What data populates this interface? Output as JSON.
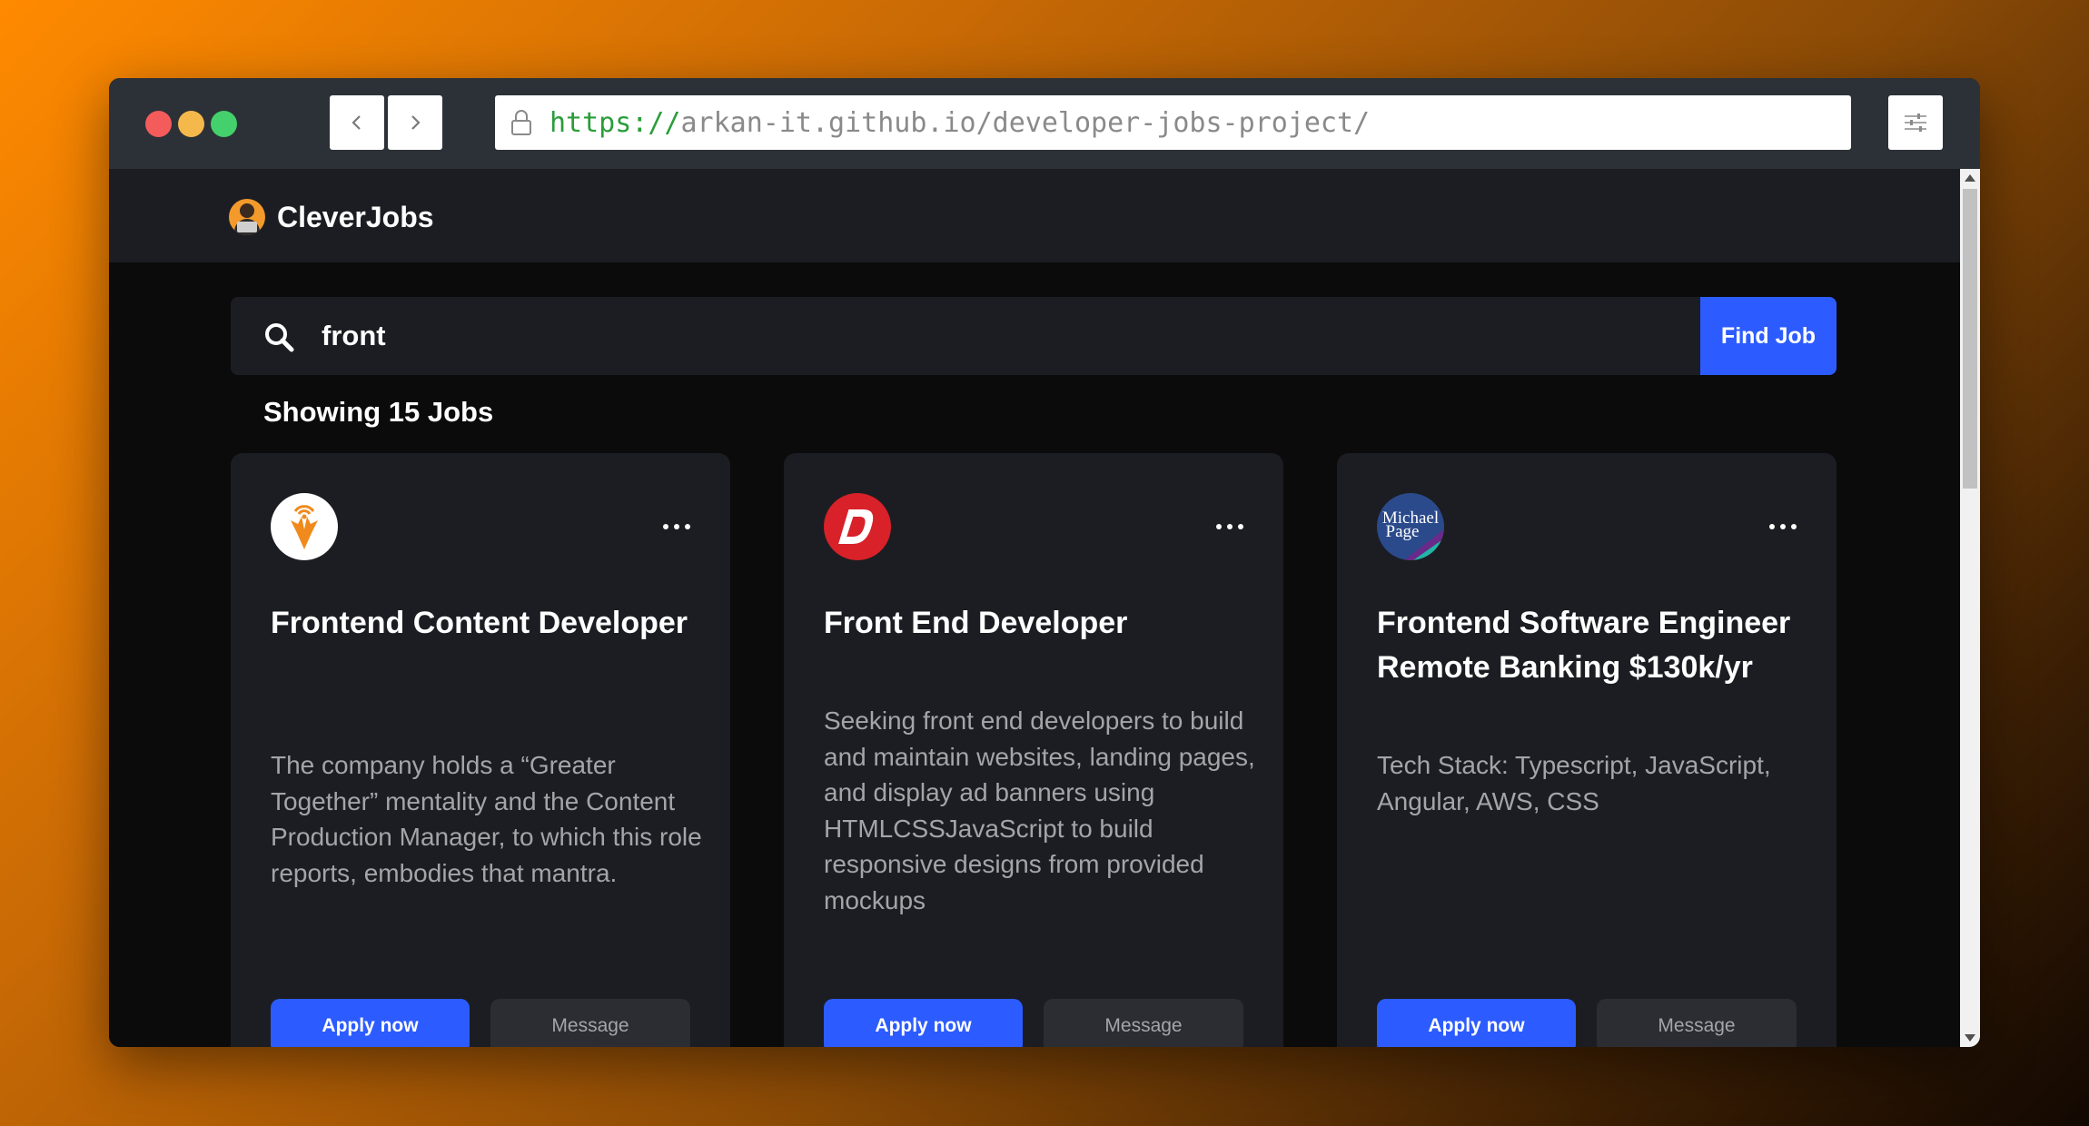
{
  "browser": {
    "url_scheme": "https://",
    "url_rest": "arkan-it.github.io/developer-jobs-project/"
  },
  "brand": {
    "name": "CleverJobs"
  },
  "search": {
    "value": "front",
    "button_label": "Find Job"
  },
  "results": {
    "count_label": "Showing 15 Jobs"
  },
  "colors": {
    "accent": "#2c5cff",
    "card_bg": "#1c1d22",
    "page_bg": "#0b0b0c"
  },
  "jobs": [
    {
      "title": "Frontend Content Developer",
      "description": "The company holds a “Greater Together” mentality and the Content Production Manager, to which this role reports, embodies that mantra.",
      "logo": "deer-logo-icon",
      "apply_label": "Apply now",
      "message_label": "Message"
    },
    {
      "title": "Front End Developer",
      "description": "Seeking front end developers to build and maintain websites, landing pages, and display ad banners using HTMLCSSJavaScript to build responsive designs from provided mockups",
      "logo": "d-letter-logo-icon",
      "apply_label": "Apply now",
      "message_label": "Message"
    },
    {
      "title": "Frontend Software Engineer Remote Banking $130k/yr",
      "description": "Tech Stack: Typescript, JavaScript, Angular, AWS, CSS",
      "logo": "michael-page-logo-icon",
      "logo_text_1": "Michael",
      "logo_text_2": "Page",
      "apply_label": "Apply now",
      "message_label": "Message"
    }
  ]
}
